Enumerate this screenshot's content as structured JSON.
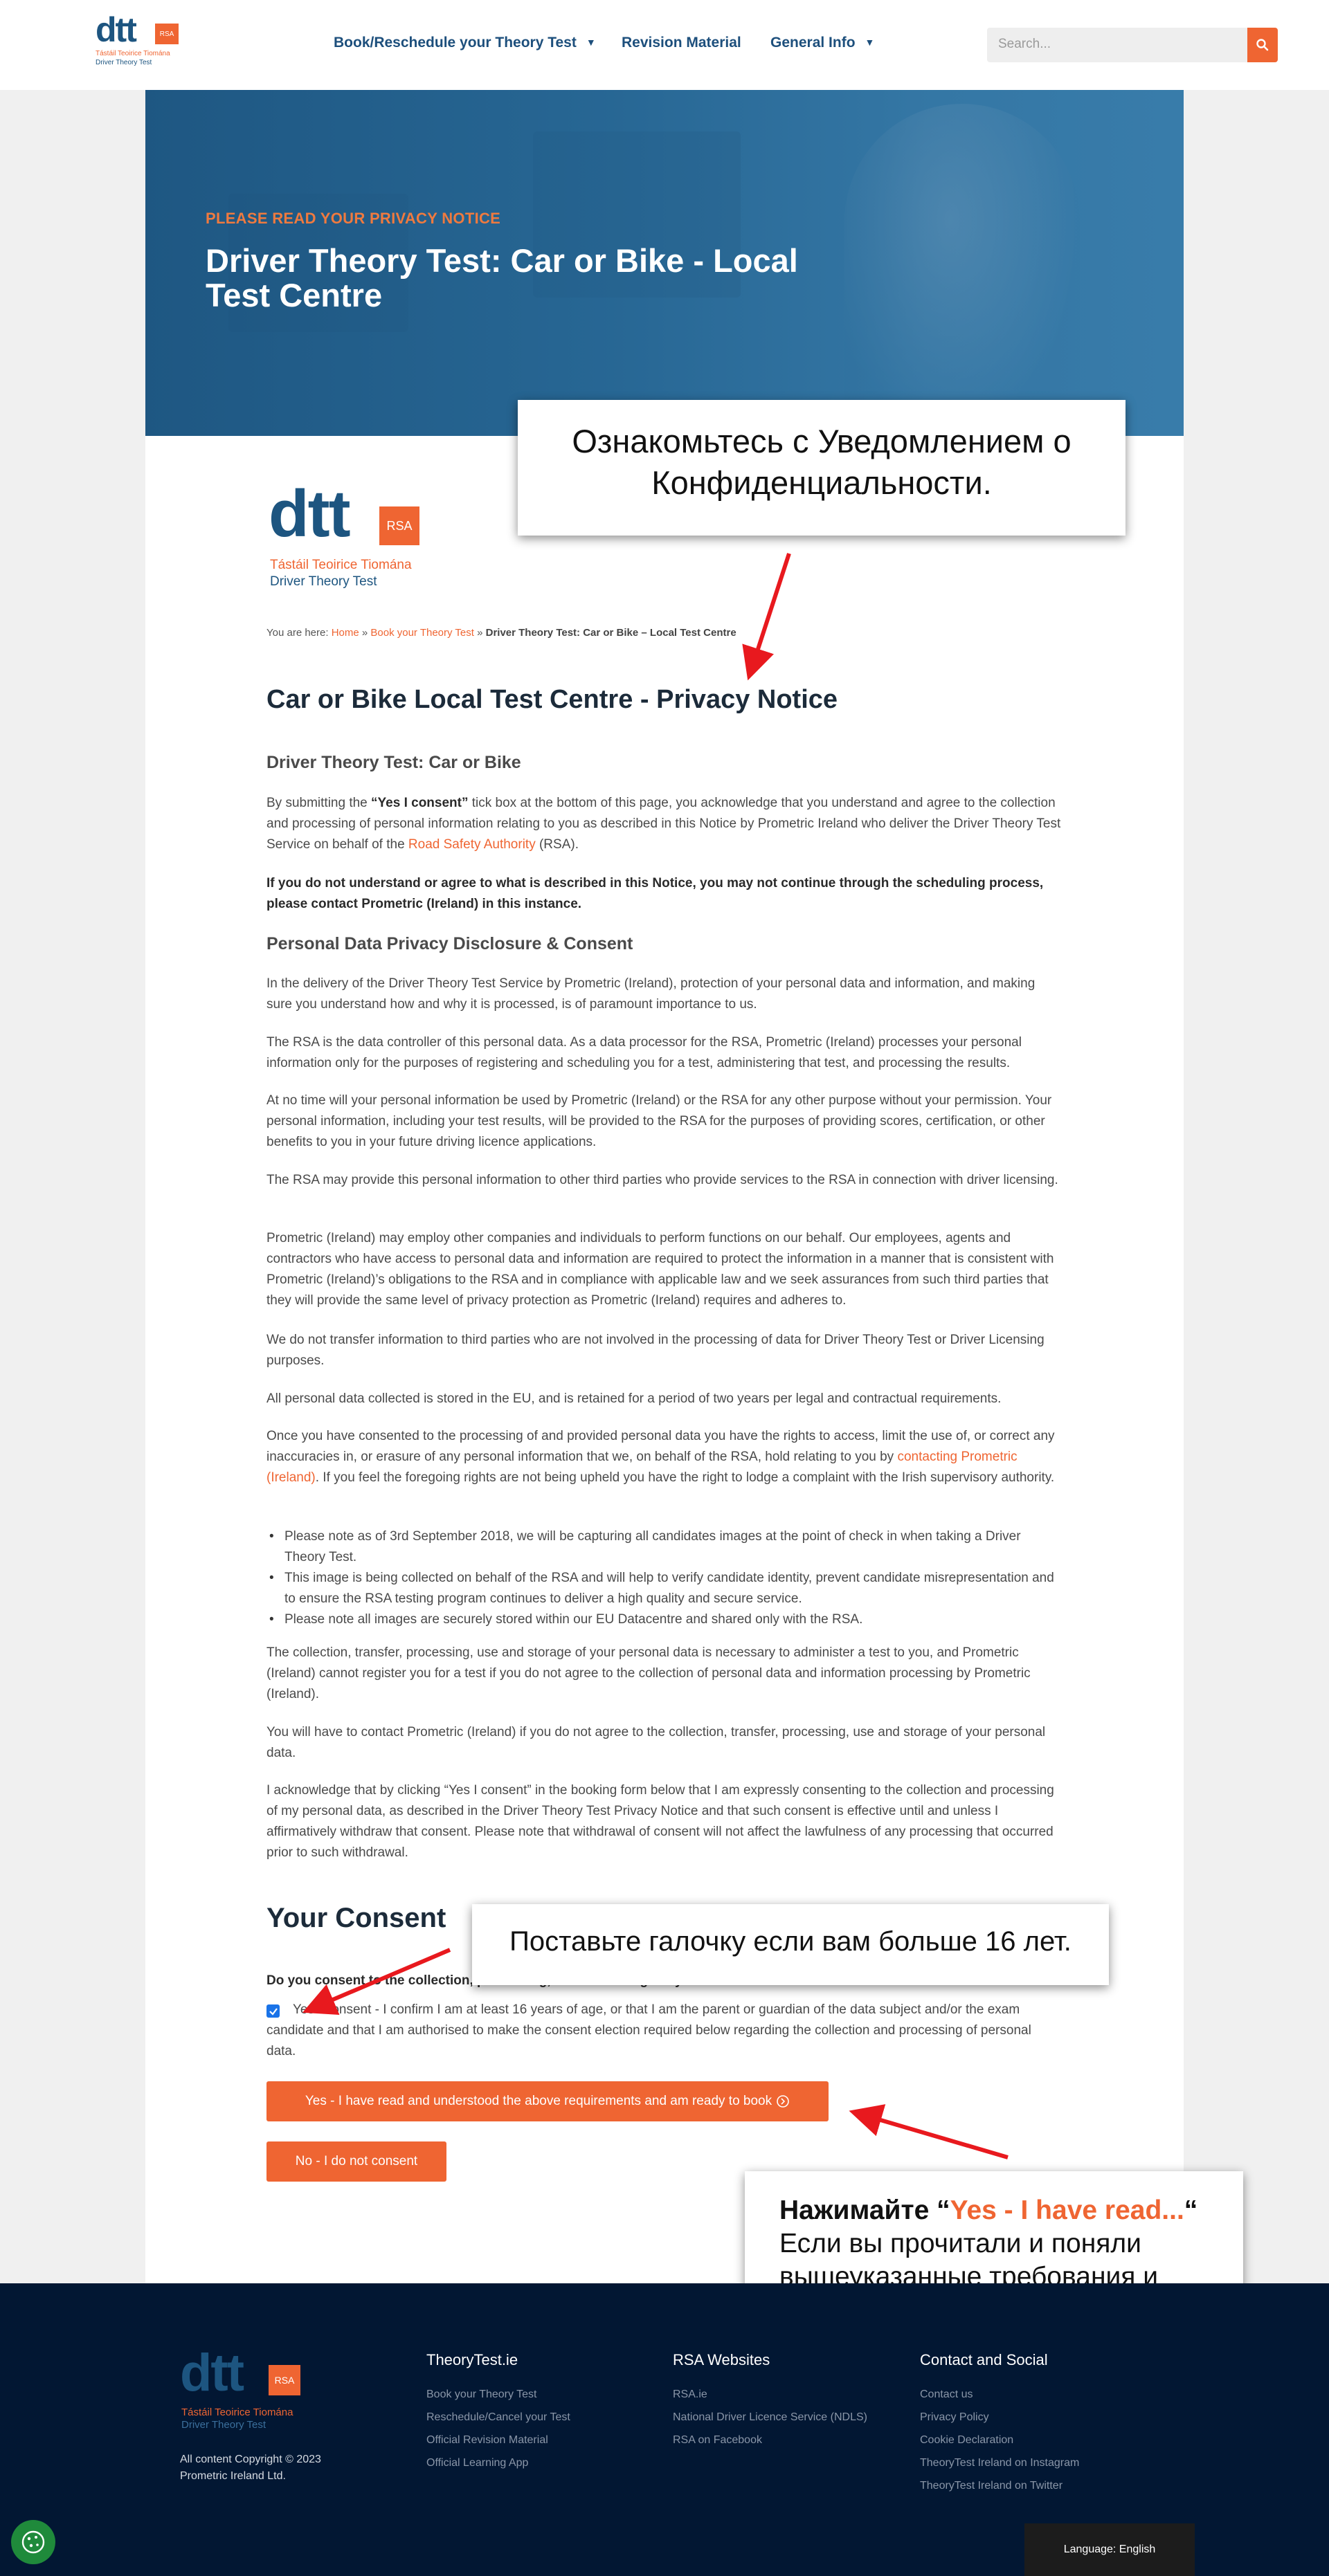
{
  "header": {
    "logo": {
      "mark": "dtt",
      "rsa": "RSA",
      "irish": "Tástáil Teoirice Tiomána",
      "english": "Driver Theory Test"
    },
    "nav": [
      {
        "label": "Book/Reschedule your Theory Test",
        "has_dropdown": true
      },
      {
        "label": "Revision Material",
        "has_dropdown": false
      },
      {
        "label": "General Info",
        "has_dropdown": true
      }
    ],
    "search": {
      "placeholder": "Search..."
    }
  },
  "hero": {
    "kicker": "PLEASE READ YOUR PRIVACY NOTICE",
    "title": "Driver Theory Test: Car or Bike - Local Test Centre"
  },
  "breadcrumb": {
    "prefix": "You are here: ",
    "home": "Home",
    "sep": " » ",
    "book": "Book your Theory Test",
    "current": "Driver Theory Test: Car or Bike – Local Test Centre"
  },
  "main": {
    "title": "Car or Bike Local Test Centre - Privacy Notice",
    "subtitle": "Driver Theory Test: Car or Bike",
    "intro": {
      "a": "By submitting the ",
      "b": "“Yes I consent”",
      "c": " tick box at the bottom of this page, you acknowledge that you understand and agree to the collection and processing of personal information relating to you as described in this Notice by Prometric Ireland who deliver the Driver Theory Test Service on behalf of the ",
      "link": "Road Safety Authority",
      "d": " (RSA)."
    },
    "warning": "If you do not understand or agree to what is described in this Notice, you may not continue through the scheduling process, please contact Prometric (Ireland) in this instance.",
    "section_title": "Personal Data Privacy Disclosure & Consent",
    "p1": "In the delivery of the Driver Theory Test Service by Prometric (Ireland), protection of your personal data and information, and making sure you understand how and why it is processed, is of paramount importance to us.",
    "p2": "The RSA is the data controller of this personal data. As a data processor for the RSA, Prometric (Ireland) processes your personal information only for the purposes of registering and scheduling you for a test, administering that test, and processing the results.",
    "p3": "At no time will your personal information be used by Prometric (Ireland) or the RSA for any other purpose without your permission. Your personal information, including your test results, will be provided to the RSA for the purposes of providing scores, certification, or other benefits to you in your future driving licence applications.",
    "p4": "The RSA may provide this personal information to other third parties who provide services to the RSA in connection with driver licensing.",
    "p5": "Prometric (Ireland) may employ other companies and individuals to perform functions on our behalf. Our employees, agents and contractors who have access to personal data and information are required to protect the information in a manner that is consistent with Prometric (Ireland)’s obligations to the RSA and in compliance with applicable law and we seek assurances from such third parties that they will provide the same level of privacy protection as Prometric (Ireland) requires and adheres to.",
    "p6": "We do not transfer information to third parties who are not involved in the processing of data for Driver Theory Test or Driver Licensing purposes.",
    "p7": "All personal data collected is stored in the EU, and is retained for a period of two years per legal and contractual requirements.",
    "p8": {
      "a": "Once you have consented to the processing of and provided personal data you have the rights to access, limit the use of, or correct any inaccuracies in, or erasure of any personal information that we, on behalf of the RSA, hold relating to you by ",
      "link": "contacting Prometric (Ireland)",
      "b": ". If you feel the foregoing rights are not being upheld you have the right to lodge a complaint with the Irish supervisory authority."
    },
    "bullets": [
      "Please note as of 3rd September 2018, we will be capturing all candidates images at the point of check in when taking a Driver Theory Test.",
      "This image is being collected on behalf of the RSA and will help to verify candidate identity, prevent candidate misrepresentation and to ensure the RSA testing program continues to deliver a high quality and secure service.",
      "Please note all images are securely stored within our EU Datacentre and shared only with the RSA."
    ],
    "p9": "The collection, transfer, processing, use and storage of your personal data is necessary to administer a test to you, and Prometric (Ireland) cannot register you for a test if you do not agree to the collection of personal data and information processing by Prometric (Ireland).",
    "p10": "You will have to contact Prometric (Ireland) if you do not agree to the collection, transfer, processing, use and storage of your personal data.",
    "p11": "I acknowledge that by clicking “Yes I consent” in the booking form below that I am expressly consenting to the collection and processing of my personal data, as described in the Driver Theory Test Privacy Notice and that such consent is effective until and unless I affirmatively withdraw that consent. Please note that withdrawal of consent will not affect the lawfulness of any processing that occurred prior to such withdrawal."
  },
  "consent": {
    "title": "Your Consent",
    "question": "Do you consent to the collection, processing, use and storage of your Personal Data and information?",
    "checked": true,
    "label": "Yes I consent - I confirm I am at least 16 years of age, or that I am the parent or guardian of the data subject and/or the exam candidate and that I am authorised to make the consent election required below regarding the collection and processing of personal data.",
    "yes_button": "Yes - I have read and understood the above requirements and am ready to book",
    "no_button": "No - I do not consent"
  },
  "annotations": {
    "a1": "Ознакомьтесь с Уведомлением о Конфиденциальности.",
    "a2": "Поставьте галочку если вам больше 16 лет.",
    "a3": {
      "bold": "Нажимайте “",
      "highlight": "Yes - I have read...",
      "bold_end": "“",
      "rest": " Если вы прочитали и поняли вышеуказанные требования и готовы забронировать."
    }
  },
  "footer": {
    "logo": {
      "mark": "dtt",
      "rsa": "RSA",
      "irish": "Tástáil Teoirice Tiomána",
      "english": "Driver Theory Test"
    },
    "copyright_line1": "All content Copyright © 2023",
    "copyright_line2": "Prometric Ireland Ltd.",
    "columns": [
      {
        "title": "TheoryTest.ie",
        "links": [
          "Book your Theory Test",
          "Reschedule/Cancel your Test",
          "Official Revision Material",
          "Official Learning App"
        ]
      },
      {
        "title": "RSA Websites",
        "links": [
          "RSA.ie",
          "National Driver Licence Service (NDLS)",
          "RSA on Facebook"
        ]
      },
      {
        "title": "Contact and Social",
        "links": [
          "Contact us",
          "Privacy Policy",
          "Cookie Declaration",
          "TheoryTest Ireland on Instagram",
          "TheoryTest Ireland on Twitter"
        ]
      }
    ],
    "language": "Language: English"
  },
  "colors": {
    "accent": "#ef6532",
    "navy": "#1d5580",
    "footer": "#021733"
  }
}
